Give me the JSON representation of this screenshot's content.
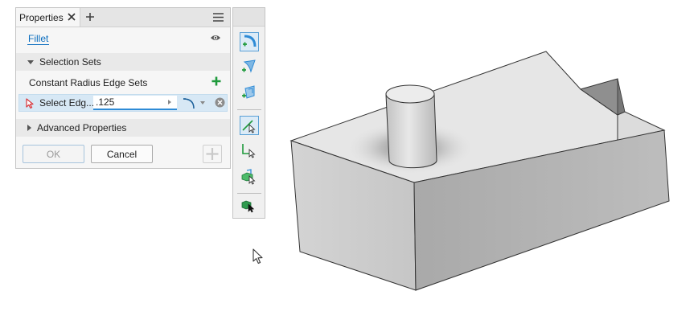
{
  "panel": {
    "tab_label": "Properties",
    "feature_name": "Fillet",
    "selection_sets_header": "Selection Sets",
    "constant_radius_label": "Constant Radius Edge Sets",
    "select_edges_label": "Select Edg...",
    "radius_value": ".125",
    "advanced_header": "Advanced Properties",
    "ok_label": "OK",
    "cancel_label": "Cancel"
  },
  "icons": {
    "tab_close": "close-icon",
    "tab_add": "plus-icon",
    "menu": "hamburger-menu-icon",
    "visibility": "eye-icon",
    "add_set": "green-plus-icon",
    "select": "red-arrow-select-icon",
    "profile": "fillet-profile-icon",
    "remove": "remove-circle-icon",
    "toolbar": [
      "edge-fillet-icon",
      "variable-fillet-icon",
      "setback-fillet-icon",
      "select-edge-icon",
      "select-loop-icon",
      "select-feature-icon",
      "select-all-icon"
    ]
  },
  "colors": {
    "accent": "#2e8bd6",
    "link": "#0a6dbf",
    "add_green": "#1f9a3c",
    "select_red": "#d8343a",
    "selection_row": "#d7e8f5"
  }
}
